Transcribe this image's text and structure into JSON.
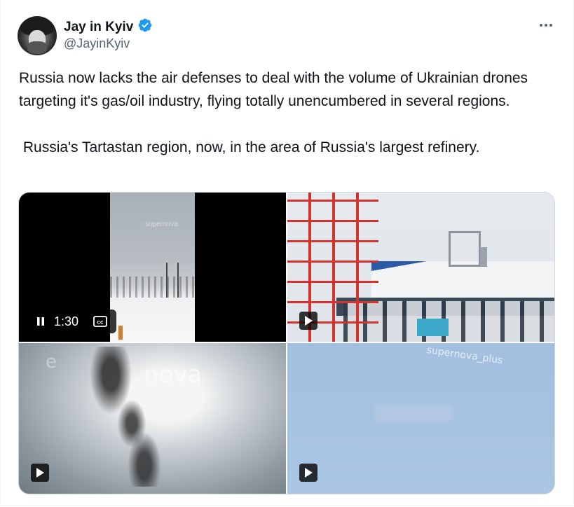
{
  "author": {
    "name": "Jay in Kyiv",
    "handle": "@JayinKyiv",
    "verified": true,
    "verified_color": "#1d9bf0"
  },
  "tweet": {
    "paragraph1": "Russia now lacks the air defenses to deal with the volume of Ukrainian drones targeting it's gas/oil industry, flying totally unencumbered in several regions.",
    "paragraph2": " Russia's Tartastan region, now, in the area of Russia's largest refinery."
  },
  "media": {
    "video1": {
      "time": "1:30",
      "playing": true,
      "captions_icon": "cc-icon",
      "watermark": "supernova"
    },
    "video2": {
      "icon": "play-icon"
    },
    "video3": {
      "icon": "play-icon",
      "watermark": "nova",
      "watermark2": "e"
    },
    "video4": {
      "icon": "play-icon",
      "watermark": "supernova_plus"
    }
  },
  "menu": {
    "icon": "more-horizontal-icon"
  },
  "colors": {
    "text": "#0f1419",
    "secondary": "#536471",
    "border": "#cfd9de"
  }
}
